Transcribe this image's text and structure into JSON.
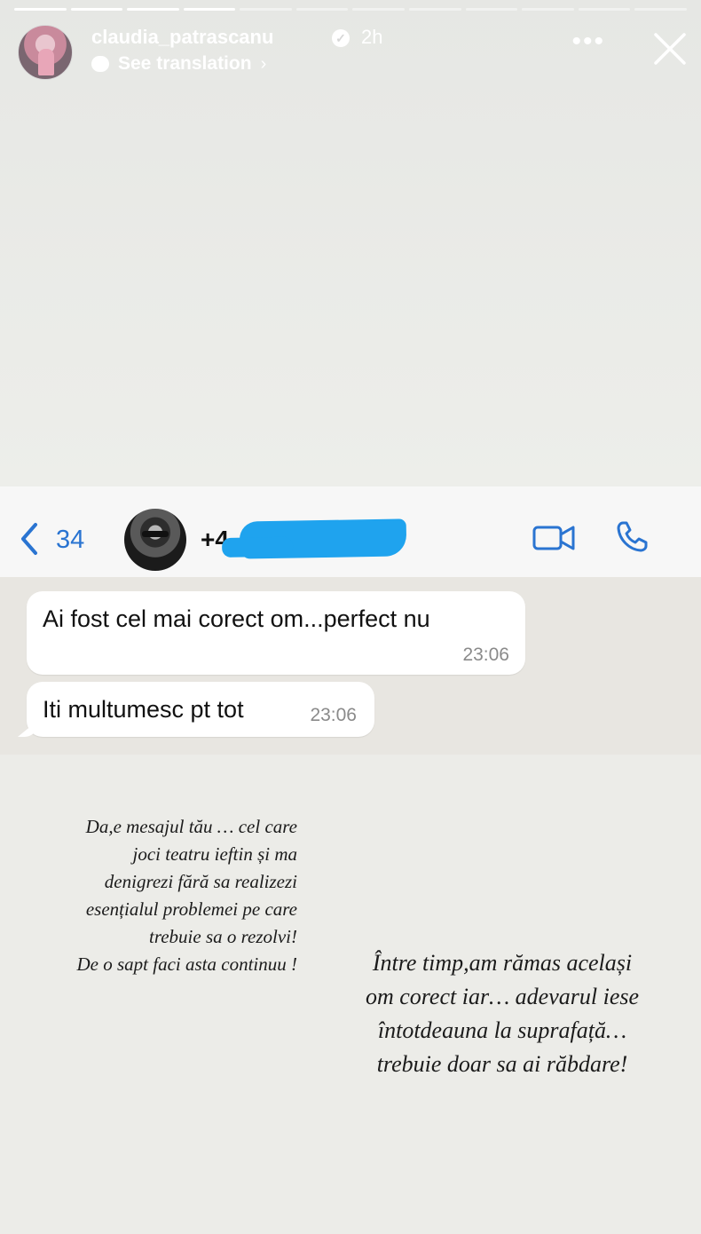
{
  "story": {
    "progress_total": 12,
    "progress_completed": 4,
    "username": "claudia_patrascanu",
    "time_ago": "2h",
    "see_translation": "See translation"
  },
  "chat": {
    "back_count": "34",
    "contact_name_visible": "+4",
    "messages": [
      {
        "text": "Ai fost cel mai corect om...perfect nu",
        "time": "23:06"
      },
      {
        "text": "Iti multumesc pt tot",
        "time": "23:06"
      }
    ]
  },
  "captions": {
    "left": [
      "Da,e mesajul tău … cel care",
      "joci teatru ieftin și ma",
      "denigrezi fără sa realizezi",
      "esențialul problemei pe care",
      "trebuie sa o rezolvi!",
      "De o sapt faci asta continuu !"
    ],
    "right": [
      "Între timp,am rămas același",
      "om corect iar… adevarul iese",
      "întotdeauna la suprafață…",
      "trebuie doar sa ai  răbdare!"
    ]
  },
  "colors": {
    "accent_blue": "#2a74d1",
    "redaction": "#1fa3ee"
  }
}
